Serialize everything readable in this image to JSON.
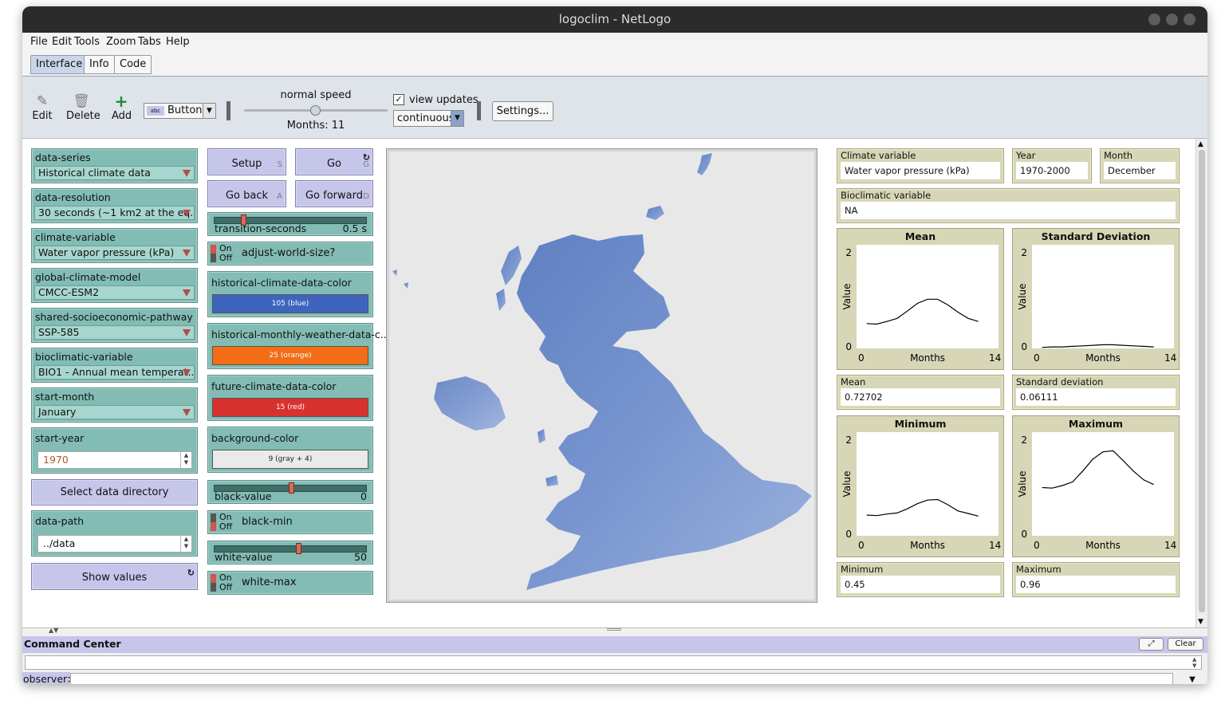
{
  "window": {
    "title": "logoclim - NetLogo"
  },
  "menu": [
    "File",
    "Edit",
    "Tools",
    "Zoom",
    "Tabs",
    "Help"
  ],
  "tabs": [
    "Interface",
    "Info",
    "Code"
  ],
  "toolbar": {
    "edit": "Edit",
    "delete": "Delete",
    "add": "Add",
    "widget_type": "Button",
    "speed_label": "normal speed",
    "ticks_label": "Months: 11",
    "view_updates_label": "view updates",
    "update_mode": "continuous",
    "settings": "Settings..."
  },
  "choosers": [
    {
      "label": "data-series",
      "value": "Historical climate data"
    },
    {
      "label": "data-resolution",
      "value": "30 seconds (~1 km2  at the eq..."
    },
    {
      "label": "climate-variable",
      "value": "Water vapor pressure (kPa)"
    },
    {
      "label": "global-climate-model",
      "value": "CMCC-ESM2"
    },
    {
      "label": "shared-socioeconomic-pathway",
      "value": "SSP-585"
    },
    {
      "label": "bioclimatic-variable",
      "value": "BIO1 - Annual mean temperat..."
    },
    {
      "label": "start-month",
      "value": "January"
    }
  ],
  "start_year": {
    "label": "start-year",
    "value": "1970"
  },
  "select_dir_button": "Select data directory",
  "data_path": {
    "label": "data-path",
    "value": "../data"
  },
  "show_values_button": "Show values",
  "buttons": {
    "setup": {
      "label": "Setup",
      "key": "S"
    },
    "go": {
      "label": "Go",
      "key": "G"
    },
    "go_back": {
      "label": "Go back",
      "key": "A"
    },
    "go_forward": {
      "label": "Go forward",
      "key": "D"
    }
  },
  "sliders": {
    "transition": {
      "name": "transition-seconds",
      "value": "0.5 s",
      "fraction": 0.18
    },
    "black": {
      "name": "black-value",
      "value": "0",
      "fraction": 0.5
    },
    "white": {
      "name": "white-value",
      "value": "50",
      "fraction": 0.55
    }
  },
  "switch_text": {
    "on": "On",
    "off": "Off"
  },
  "switches": {
    "adjust": "adjust-world-size?",
    "black_min": "black-min",
    "white_max": "white-max"
  },
  "color_inputs": [
    {
      "label": "historical-climate-data-color",
      "value": "105 (blue)",
      "color": "#3e64bd",
      "text_color": "#ffffff"
    },
    {
      "label": "historical-monthly-weather-data-c...",
      "value": "25 (orange)",
      "color": "#f26d15",
      "text_color": "#ffffff"
    },
    {
      "label": "future-climate-data-color",
      "value": "15 (red)",
      "color": "#d7322d",
      "text_color": "#ffffff"
    },
    {
      "label": "background-color",
      "value": "9 (gray + 4)",
      "color": "#eaeaea",
      "text_color": "#222222"
    }
  ],
  "monitors": {
    "climate_variable": {
      "label": "Climate variable",
      "value": "Water vapor pressure (kPa)"
    },
    "year": {
      "label": "Year",
      "value": "1970-2000"
    },
    "month": {
      "label": "Month",
      "value": "December"
    },
    "bioclimatic": {
      "label": "Bioclimatic variable",
      "value": "NA"
    },
    "mean": {
      "label": "Mean",
      "value": "0.72702"
    },
    "std": {
      "label": "Standard deviation",
      "value": "0.06111"
    },
    "min": {
      "label": "Minimum",
      "value": "0.45"
    },
    "max": {
      "label": "Maximum",
      "value": "0.96"
    }
  },
  "plots": {
    "mean": {
      "title": "Mean"
    },
    "std": {
      "title": "Standard Deviation"
    },
    "minimum": {
      "title": "Minimum"
    },
    "maximum": {
      "title": "Maximum"
    },
    "ylabel": "Value",
    "xlabel": "Months",
    "xmin": "0",
    "xmax": "14",
    "ymin": "0",
    "ymax": "2"
  },
  "chart_data": [
    {
      "type": "line",
      "title": "Mean",
      "xlabel": "Months",
      "ylabel": "Value",
      "xlim": [
        0,
        14
      ],
      "ylim": [
        0,
        2
      ],
      "x": [
        1,
        2,
        3,
        4,
        5,
        6,
        7,
        8,
        9,
        10,
        11,
        12
      ],
      "values": [
        0.48,
        0.47,
        0.52,
        0.58,
        0.72,
        0.87,
        0.95,
        0.95,
        0.84,
        0.7,
        0.58,
        0.52
      ]
    },
    {
      "type": "line",
      "title": "Standard Deviation",
      "xlabel": "Months",
      "ylabel": "Value",
      "xlim": [
        0,
        14
      ],
      "ylim": [
        0,
        2
      ],
      "x": [
        1,
        2,
        3,
        4,
        5,
        6,
        7,
        8,
        9,
        10,
        11,
        12
      ],
      "values": [
        0.02,
        0.03,
        0.03,
        0.04,
        0.05,
        0.06,
        0.07,
        0.07,
        0.06,
        0.05,
        0.04,
        0.03
      ]
    },
    {
      "type": "line",
      "title": "Minimum",
      "xlabel": "Months",
      "ylabel": "Value",
      "xlim": [
        0,
        14
      ],
      "ylim": [
        0,
        2
      ],
      "x": [
        1,
        2,
        3,
        4,
        5,
        6,
        7,
        8,
        9,
        10,
        11,
        12
      ],
      "values": [
        0.4,
        0.39,
        0.42,
        0.44,
        0.52,
        0.62,
        0.69,
        0.7,
        0.6,
        0.48,
        0.43,
        0.38
      ]
    },
    {
      "type": "line",
      "title": "Maximum",
      "xlabel": "Months",
      "ylabel": "Value",
      "xlim": [
        0,
        14
      ],
      "ylim": [
        0,
        2
      ],
      "x": [
        1,
        2,
        3,
        4,
        5,
        6,
        7,
        8,
        9,
        10,
        11,
        12
      ],
      "values": [
        0.93,
        0.92,
        0.97,
        1.04,
        1.25,
        1.48,
        1.62,
        1.64,
        1.45,
        1.25,
        1.08,
        0.99
      ]
    }
  ],
  "command_center": {
    "title": "Command Center",
    "clear": "Clear",
    "observer": "observer>"
  },
  "colors": {
    "chooser": "#82bcb4",
    "button": "#c6c5ea",
    "monitor": "#d7d6b6",
    "map": "#6f8fca"
  }
}
